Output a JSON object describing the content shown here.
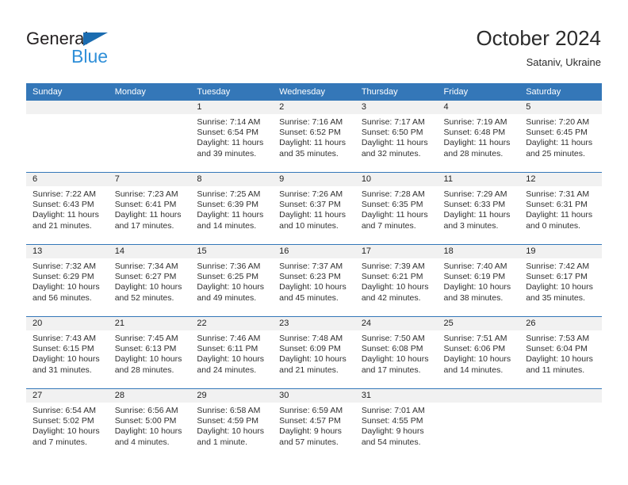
{
  "brand": {
    "name_top": "General",
    "name_bottom": "Blue",
    "triangle_color": "#1b6cb0",
    "blue_text_color": "#2f8fd8"
  },
  "header": {
    "title": "October 2024",
    "subtitle": "Sataniv, Ukraine"
  },
  "colors": {
    "header_blue": "#3477b8",
    "daynum_band": "#f1f1f1",
    "body_text": "#303030"
  },
  "weekday_headers": [
    "Sunday",
    "Monday",
    "Tuesday",
    "Wednesday",
    "Thursday",
    "Friday",
    "Saturday"
  ],
  "weeks": [
    [
      {
        "day": "",
        "blank": true,
        "lines": []
      },
      {
        "day": "",
        "blank": true,
        "lines": []
      },
      {
        "day": "1",
        "lines": [
          "Sunrise: 7:14 AM",
          "Sunset: 6:54 PM",
          "Daylight: 11 hours",
          "and 39 minutes."
        ]
      },
      {
        "day": "2",
        "lines": [
          "Sunrise: 7:16 AM",
          "Sunset: 6:52 PM",
          "Daylight: 11 hours",
          "and 35 minutes."
        ]
      },
      {
        "day": "3",
        "lines": [
          "Sunrise: 7:17 AM",
          "Sunset: 6:50 PM",
          "Daylight: 11 hours",
          "and 32 minutes."
        ]
      },
      {
        "day": "4",
        "lines": [
          "Sunrise: 7:19 AM",
          "Sunset: 6:48 PM",
          "Daylight: 11 hours",
          "and 28 minutes."
        ]
      },
      {
        "day": "5",
        "lines": [
          "Sunrise: 7:20 AM",
          "Sunset: 6:45 PM",
          "Daylight: 11 hours",
          "and 25 minutes."
        ]
      }
    ],
    [
      {
        "day": "6",
        "lines": [
          "Sunrise: 7:22 AM",
          "Sunset: 6:43 PM",
          "Daylight: 11 hours",
          "and 21 minutes."
        ]
      },
      {
        "day": "7",
        "lines": [
          "Sunrise: 7:23 AM",
          "Sunset: 6:41 PM",
          "Daylight: 11 hours",
          "and 17 minutes."
        ]
      },
      {
        "day": "8",
        "lines": [
          "Sunrise: 7:25 AM",
          "Sunset: 6:39 PM",
          "Daylight: 11 hours",
          "and 14 minutes."
        ]
      },
      {
        "day": "9",
        "lines": [
          "Sunrise: 7:26 AM",
          "Sunset: 6:37 PM",
          "Daylight: 11 hours",
          "and 10 minutes."
        ]
      },
      {
        "day": "10",
        "lines": [
          "Sunrise: 7:28 AM",
          "Sunset: 6:35 PM",
          "Daylight: 11 hours",
          "and 7 minutes."
        ]
      },
      {
        "day": "11",
        "lines": [
          "Sunrise: 7:29 AM",
          "Sunset: 6:33 PM",
          "Daylight: 11 hours",
          "and 3 minutes."
        ]
      },
      {
        "day": "12",
        "lines": [
          "Sunrise: 7:31 AM",
          "Sunset: 6:31 PM",
          "Daylight: 11 hours",
          "and 0 minutes."
        ]
      }
    ],
    [
      {
        "day": "13",
        "lines": [
          "Sunrise: 7:32 AM",
          "Sunset: 6:29 PM",
          "Daylight: 10 hours",
          "and 56 minutes."
        ]
      },
      {
        "day": "14",
        "lines": [
          "Sunrise: 7:34 AM",
          "Sunset: 6:27 PM",
          "Daylight: 10 hours",
          "and 52 minutes."
        ]
      },
      {
        "day": "15",
        "lines": [
          "Sunrise: 7:36 AM",
          "Sunset: 6:25 PM",
          "Daylight: 10 hours",
          "and 49 minutes."
        ]
      },
      {
        "day": "16",
        "lines": [
          "Sunrise: 7:37 AM",
          "Sunset: 6:23 PM",
          "Daylight: 10 hours",
          "and 45 minutes."
        ]
      },
      {
        "day": "17",
        "lines": [
          "Sunrise: 7:39 AM",
          "Sunset: 6:21 PM",
          "Daylight: 10 hours",
          "and 42 minutes."
        ]
      },
      {
        "day": "18",
        "lines": [
          "Sunrise: 7:40 AM",
          "Sunset: 6:19 PM",
          "Daylight: 10 hours",
          "and 38 minutes."
        ]
      },
      {
        "day": "19",
        "lines": [
          "Sunrise: 7:42 AM",
          "Sunset: 6:17 PM",
          "Daylight: 10 hours",
          "and 35 minutes."
        ]
      }
    ],
    [
      {
        "day": "20",
        "lines": [
          "Sunrise: 7:43 AM",
          "Sunset: 6:15 PM",
          "Daylight: 10 hours",
          "and 31 minutes."
        ]
      },
      {
        "day": "21",
        "lines": [
          "Sunrise: 7:45 AM",
          "Sunset: 6:13 PM",
          "Daylight: 10 hours",
          "and 28 minutes."
        ]
      },
      {
        "day": "22",
        "lines": [
          "Sunrise: 7:46 AM",
          "Sunset: 6:11 PM",
          "Daylight: 10 hours",
          "and 24 minutes."
        ]
      },
      {
        "day": "23",
        "lines": [
          "Sunrise: 7:48 AM",
          "Sunset: 6:09 PM",
          "Daylight: 10 hours",
          "and 21 minutes."
        ]
      },
      {
        "day": "24",
        "lines": [
          "Sunrise: 7:50 AM",
          "Sunset: 6:08 PM",
          "Daylight: 10 hours",
          "and 17 minutes."
        ]
      },
      {
        "day": "25",
        "lines": [
          "Sunrise: 7:51 AM",
          "Sunset: 6:06 PM",
          "Daylight: 10 hours",
          "and 14 minutes."
        ]
      },
      {
        "day": "26",
        "lines": [
          "Sunrise: 7:53 AM",
          "Sunset: 6:04 PM",
          "Daylight: 10 hours",
          "and 11 minutes."
        ]
      }
    ],
    [
      {
        "day": "27",
        "lines": [
          "Sunrise: 6:54 AM",
          "Sunset: 5:02 PM",
          "Daylight: 10 hours",
          "and 7 minutes."
        ]
      },
      {
        "day": "28",
        "lines": [
          "Sunrise: 6:56 AM",
          "Sunset: 5:00 PM",
          "Daylight: 10 hours",
          "and 4 minutes."
        ]
      },
      {
        "day": "29",
        "lines": [
          "Sunrise: 6:58 AM",
          "Sunset: 4:59 PM",
          "Daylight: 10 hours",
          "and 1 minute."
        ]
      },
      {
        "day": "30",
        "lines": [
          "Sunrise: 6:59 AM",
          "Sunset: 4:57 PM",
          "Daylight: 9 hours",
          "and 57 minutes."
        ]
      },
      {
        "day": "31",
        "lines": [
          "Sunrise: 7:01 AM",
          "Sunset: 4:55 PM",
          "Daylight: 9 hours",
          "and 54 minutes."
        ]
      },
      {
        "day": "",
        "blank": true,
        "lines": []
      },
      {
        "day": "",
        "blank": true,
        "lines": []
      }
    ]
  ]
}
